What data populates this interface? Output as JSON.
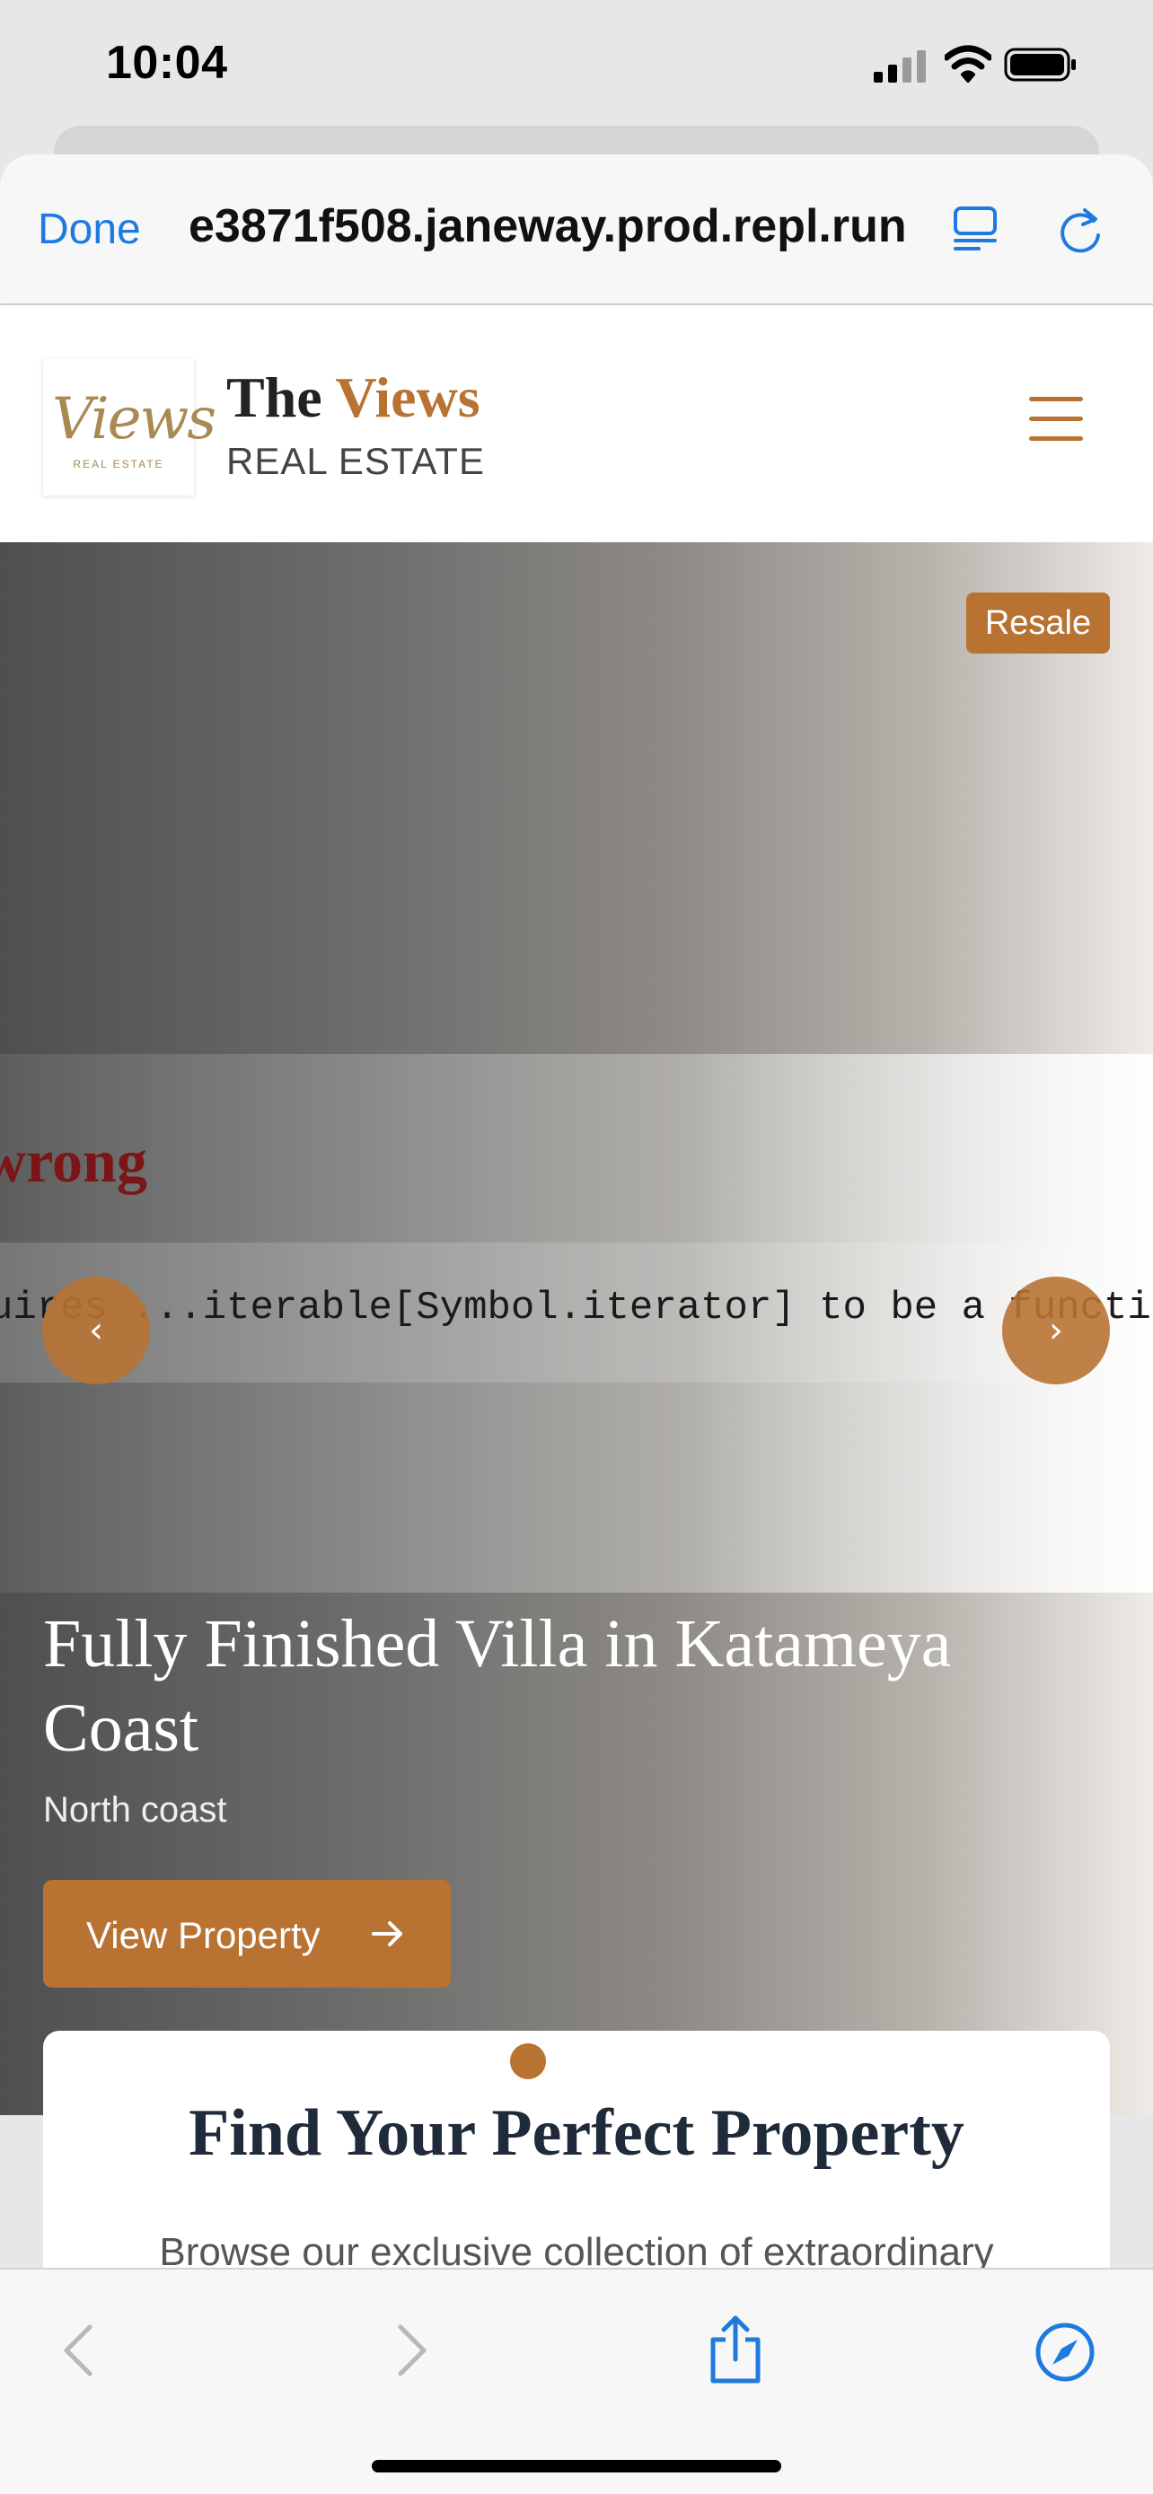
{
  "status_bar": {
    "time": "10:04"
  },
  "browser": {
    "done_label": "Done",
    "url": "e3871f508.janeway.prod.repl.run"
  },
  "site_header": {
    "logo_script": "Views",
    "logo_small": "REAL ESTATE",
    "brand_the": "The",
    "brand_views": "Views",
    "brand_sub": "REAL ESTATE"
  },
  "hero": {
    "badge": "Resale",
    "error_title": "wrong",
    "error_message": "uires ...iterable[Symbol.iterator] to be a functio",
    "prev_label": "‹",
    "next_label": "›",
    "title": "Fully Finished Villa in Katameya Coast",
    "location": "North coast",
    "cta_label": "View Property"
  },
  "find_section": {
    "title": "Find Your Perfect Property",
    "description": "Browse our exclusive collection of extraordinary"
  },
  "colors": {
    "accent": "#b87333",
    "link": "#1f7ae0",
    "error": "#7a1616"
  }
}
